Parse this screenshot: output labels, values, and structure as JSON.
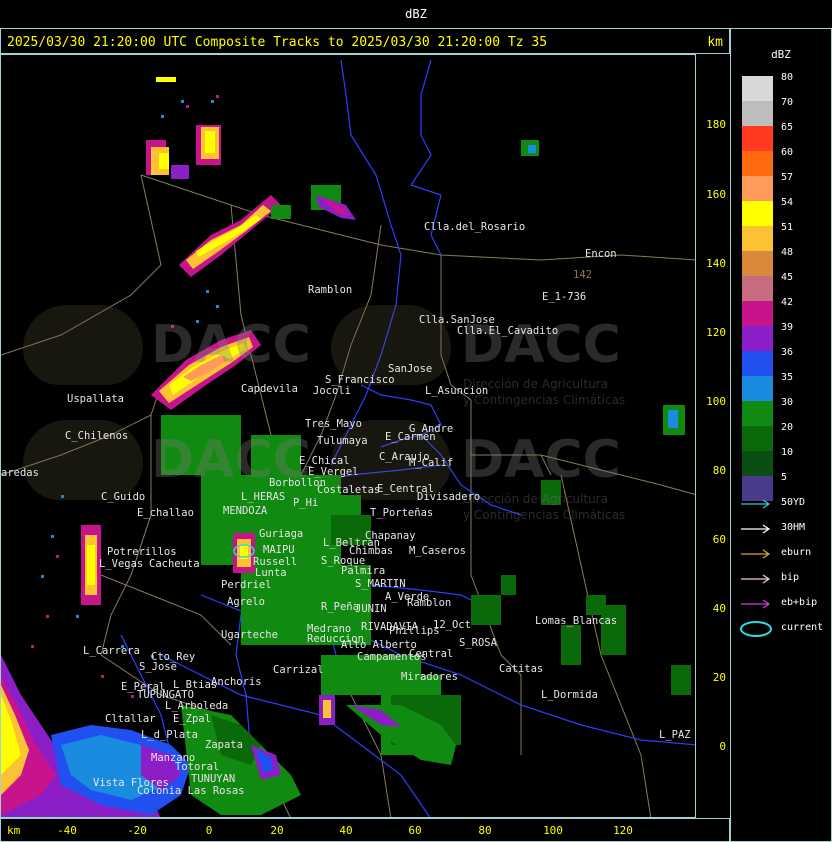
{
  "top_title": "dBZ",
  "header": {
    "text": "2025/03/30 21:20:00 UTC Composite Tracks to 2025/03/30 21:20:00 Tz 35",
    "unit": "km"
  },
  "y_axis": {
    "ticks": [
      "180",
      "160",
      "140",
      "120",
      "100",
      "80",
      "60",
      "40",
      "20",
      "0"
    ]
  },
  "x_axis": {
    "unit": "km",
    "ticks": [
      "-40",
      "-20",
      "0",
      "20",
      "40",
      "60",
      "80",
      "100",
      "120"
    ]
  },
  "legend": {
    "title": "dBZ",
    "levels": [
      {
        "label": "80",
        "color": "#d8d8d8"
      },
      {
        "label": "70",
        "color": "#bdbdbd"
      },
      {
        "label": "65",
        "color": "#ff3a20"
      },
      {
        "label": "60",
        "color": "#ff6a10"
      },
      {
        "label": "57",
        "color": "#ff9a5a"
      },
      {
        "label": "54",
        "color": "#ffff00"
      },
      {
        "label": "51",
        "color": "#fcc232"
      },
      {
        "label": "48",
        "color": "#d88a3a"
      },
      {
        "label": "45",
        "color": "#c86a80"
      },
      {
        "label": "42",
        "color": "#c8148c"
      },
      {
        "label": "39",
        "color": "#8c1ec8"
      },
      {
        "label": "36",
        "color": "#2050f0"
      },
      {
        "label": "35",
        "color": "#1a8ce0"
      },
      {
        "label": "30",
        "color": "#108a10"
      },
      {
        "label": "20",
        "color": "#0a6a0a"
      },
      {
        "label": "10",
        "color": "#0a4e14"
      },
      {
        "label": "5",
        "color": "#4a3a8c"
      }
    ],
    "tracks": [
      {
        "label": "50YD",
        "color": "#3ac8d0",
        "icon": "arrow"
      },
      {
        "label": "30HM",
        "color": "#ffffff",
        "icon": "arrow"
      },
      {
        "label": "eburn",
        "color": "#e0a040",
        "icon": "arrow"
      },
      {
        "label": "bip",
        "color": "#f0c8d0",
        "icon": "arrow"
      },
      {
        "label": "eb+bip",
        "color": "#d040d0",
        "icon": "arrow"
      },
      {
        "label": "current",
        "color": "#30d8e0",
        "icon": "ellipse"
      }
    ]
  },
  "watermark": {
    "brand": "DACC",
    "line1": "Dirección de Agricultura",
    "line2": "y Contingencias Climáticas"
  },
  "cities": [
    {
      "name": "Clla.del_Rosario"
    },
    {
      "name": "Encon"
    },
    {
      "name": "142"
    },
    {
      "name": "E_1-736"
    },
    {
      "name": "Ramblon"
    },
    {
      "name": "Clla.SanJose"
    },
    {
      "name": "Clla.El_Cavadito"
    },
    {
      "name": "Uspallata"
    },
    {
      "name": "Capdevila"
    },
    {
      "name": "S_Francisco"
    },
    {
      "name": "Jocoli"
    },
    {
      "name": "SanJose"
    },
    {
      "name": "L_Asuncion"
    },
    {
      "name": "C_Chilenos"
    },
    {
      "name": "Tres_Mayo"
    },
    {
      "name": "Tulumaya"
    },
    {
      "name": "E_Carmen"
    },
    {
      "name": "G_Andre"
    },
    {
      "name": "E_Chical"
    },
    {
      "name": "E_Vergel"
    },
    {
      "name": "C_Araujo"
    },
    {
      "name": "M_Calif"
    },
    {
      "name": "aredas"
    },
    {
      "name": "Borbollon"
    },
    {
      "name": "Costaletas"
    },
    {
      "name": "E_Central"
    },
    {
      "name": "Divisadero"
    },
    {
      "name": "C_Guido"
    },
    {
      "name": "L_HERAS"
    },
    {
      "name": "P_Hi"
    },
    {
      "name": "E_challao"
    },
    {
      "name": "MENDOZA"
    },
    {
      "name": "T_Porteñas"
    },
    {
      "name": "Guriaga"
    },
    {
      "name": "Chapanay"
    },
    {
      "name": "L_Beltran"
    },
    {
      "name": "Potrerillos"
    },
    {
      "name": "MAIPU"
    },
    {
      "name": "Chimbas"
    },
    {
      "name": "M_Caseros"
    },
    {
      "name": "L_Vegas"
    },
    {
      "name": "Cacheuta"
    },
    {
      "name": "Russell"
    },
    {
      "name": "S_Roque"
    },
    {
      "name": "Lunta"
    },
    {
      "name": "Palmira"
    },
    {
      "name": "Perdriel"
    },
    {
      "name": "S_MARTIN"
    },
    {
      "name": "A_Verde"
    },
    {
      "name": "Ramblon"
    },
    {
      "name": "Agrelo"
    },
    {
      "name": "R_Peña"
    },
    {
      "name": "JUNIN"
    },
    {
      "name": "Lomas_Blancas"
    },
    {
      "name": "Ugarteche"
    },
    {
      "name": "Medrano"
    },
    {
      "name": "Reduccion"
    },
    {
      "name": "RIVADAVIA"
    },
    {
      "name": "Phillips"
    },
    {
      "name": "12_Oct"
    },
    {
      "name": "S_ROSA"
    },
    {
      "name": "L_Carrera"
    },
    {
      "name": "Cto_Rey"
    },
    {
      "name": "Alto Alberto"
    },
    {
      "name": "Campamentos"
    },
    {
      "name": "Central"
    },
    {
      "name": "S_Jose"
    },
    {
      "name": "Carrizal"
    },
    {
      "name": "Catitas"
    },
    {
      "name": "E_Peral"
    },
    {
      "name": "L_Btias"
    },
    {
      "name": "Anchoris"
    },
    {
      "name": "TUPUNGATO"
    },
    {
      "name": "Miradores"
    },
    {
      "name": "L_Dormida"
    },
    {
      "name": "L_Arboleda"
    },
    {
      "name": "Cltallar"
    },
    {
      "name": "E_Zpal"
    },
    {
      "name": "L_PAZ"
    },
    {
      "name": "L_d_Plata"
    },
    {
      "name": "Zapata"
    },
    {
      "name": "Manzano"
    },
    {
      "name": "Totoral"
    },
    {
      "name": "TUNUYAN"
    },
    {
      "name": "Vista Flores"
    },
    {
      "name": "Colonia Las Rosas"
    }
  ]
}
